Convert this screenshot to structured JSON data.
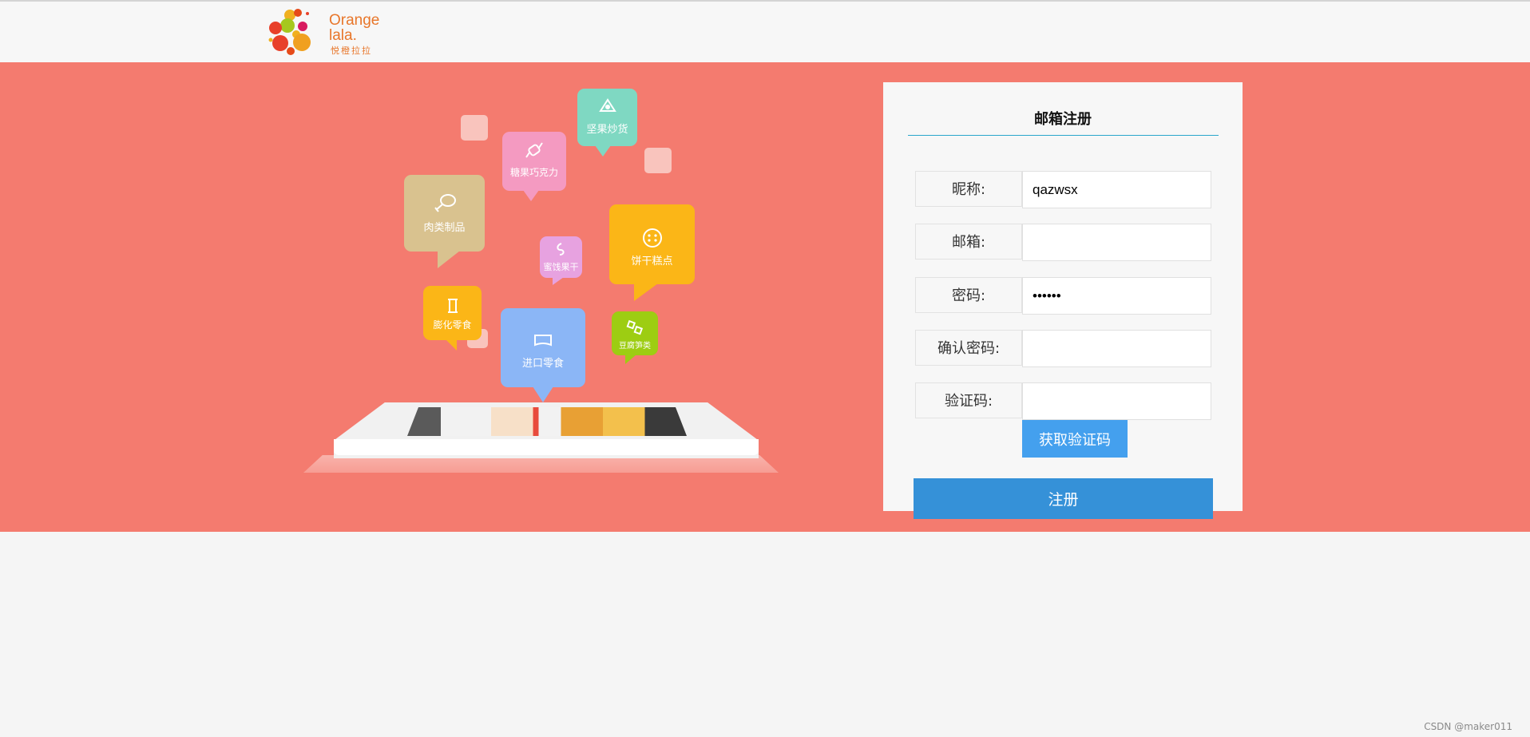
{
  "brand": {
    "name_line1": "Orange",
    "name_line2": "lala.",
    "sub": "悦橙拉拉"
  },
  "illustration": {
    "bubbles": {
      "nuts": "坚果炒货",
      "candy": "糖果巧克力",
      "meat": "肉类制品",
      "fruit": "蜜饯果干",
      "biscuit": "饼干糕点",
      "puffed": "膨化零食",
      "imported": "进口零食",
      "bean": "豆腐笋类"
    }
  },
  "form": {
    "title": "邮箱注册",
    "nickname_label": "昵称:",
    "nickname_value": "qazwsx",
    "email_label": "邮箱:",
    "email_value": "",
    "password_label": "密码:",
    "password_value": "123456",
    "confirm_label": "确认密码:",
    "confirm_value": "",
    "code_label": "验证码:",
    "code_value": "",
    "get_code_label": "获取验证码",
    "register_label": "注册"
  },
  "watermark": "CSDN @maker011",
  "colors": {
    "banner": "#f47b6f",
    "accent": "#3591d8",
    "code_button": "#44a0ee",
    "title_line": "#2ba6cb"
  }
}
